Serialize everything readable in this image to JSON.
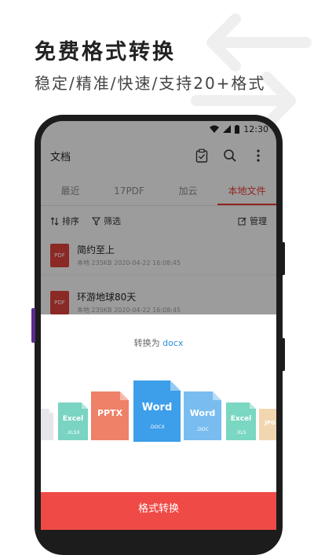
{
  "promo": {
    "title": "免费格式转换",
    "subtitle": "稳定/精准/快速/支持20+格式"
  },
  "status_bar": {
    "time": "12:30"
  },
  "app_bar": {
    "title": "文档",
    "icons": [
      "clipboard-check-icon",
      "search-icon",
      "more-vert-icon"
    ]
  },
  "tabs": [
    {
      "label": "最近",
      "active": false
    },
    {
      "label": "17PDF",
      "active": false
    },
    {
      "label": "加云",
      "active": false
    },
    {
      "label": "本地文件",
      "active": true
    }
  ],
  "toolbar": {
    "sort_label": "排序",
    "filter_label": "筛选",
    "manage_label": "管理"
  },
  "files": [
    {
      "icon_label": "PDF",
      "name": "简约至上",
      "meta": "本地 235KB 2020-04-22 16:08:45"
    },
    {
      "icon_label": "PDF",
      "name": "环游地球80天",
      "meta": "本地 235KB 2020-04-22 16:08:45"
    }
  ],
  "sheet": {
    "convert_prefix": "转换为",
    "convert_format": "docx",
    "button_label": "格式转换",
    "cards": [
      {
        "name": "",
        "ext": "",
        "color": "#e6e6ea"
      },
      {
        "name": "Excel",
        "ext": ".XLSX",
        "color": "#79d4c1"
      },
      {
        "name": "PPTX",
        "ext": "",
        "color": "#ee8167"
      },
      {
        "name": "Word",
        "ext": ".DOCX",
        "color": "#3d9eea"
      },
      {
        "name": "Word",
        "ext": ".DOC",
        "color": "#79bdf0"
      },
      {
        "name": "Excel",
        "ext": ".XLS",
        "color": "#7ad7c2"
      },
      {
        "name": "JPG",
        "ext": "",
        "color": "#f2d6b0"
      }
    ]
  },
  "colors": {
    "accent": "#ef4a45",
    "link": "#2a8fd8",
    "pdf": "#d9403a"
  }
}
